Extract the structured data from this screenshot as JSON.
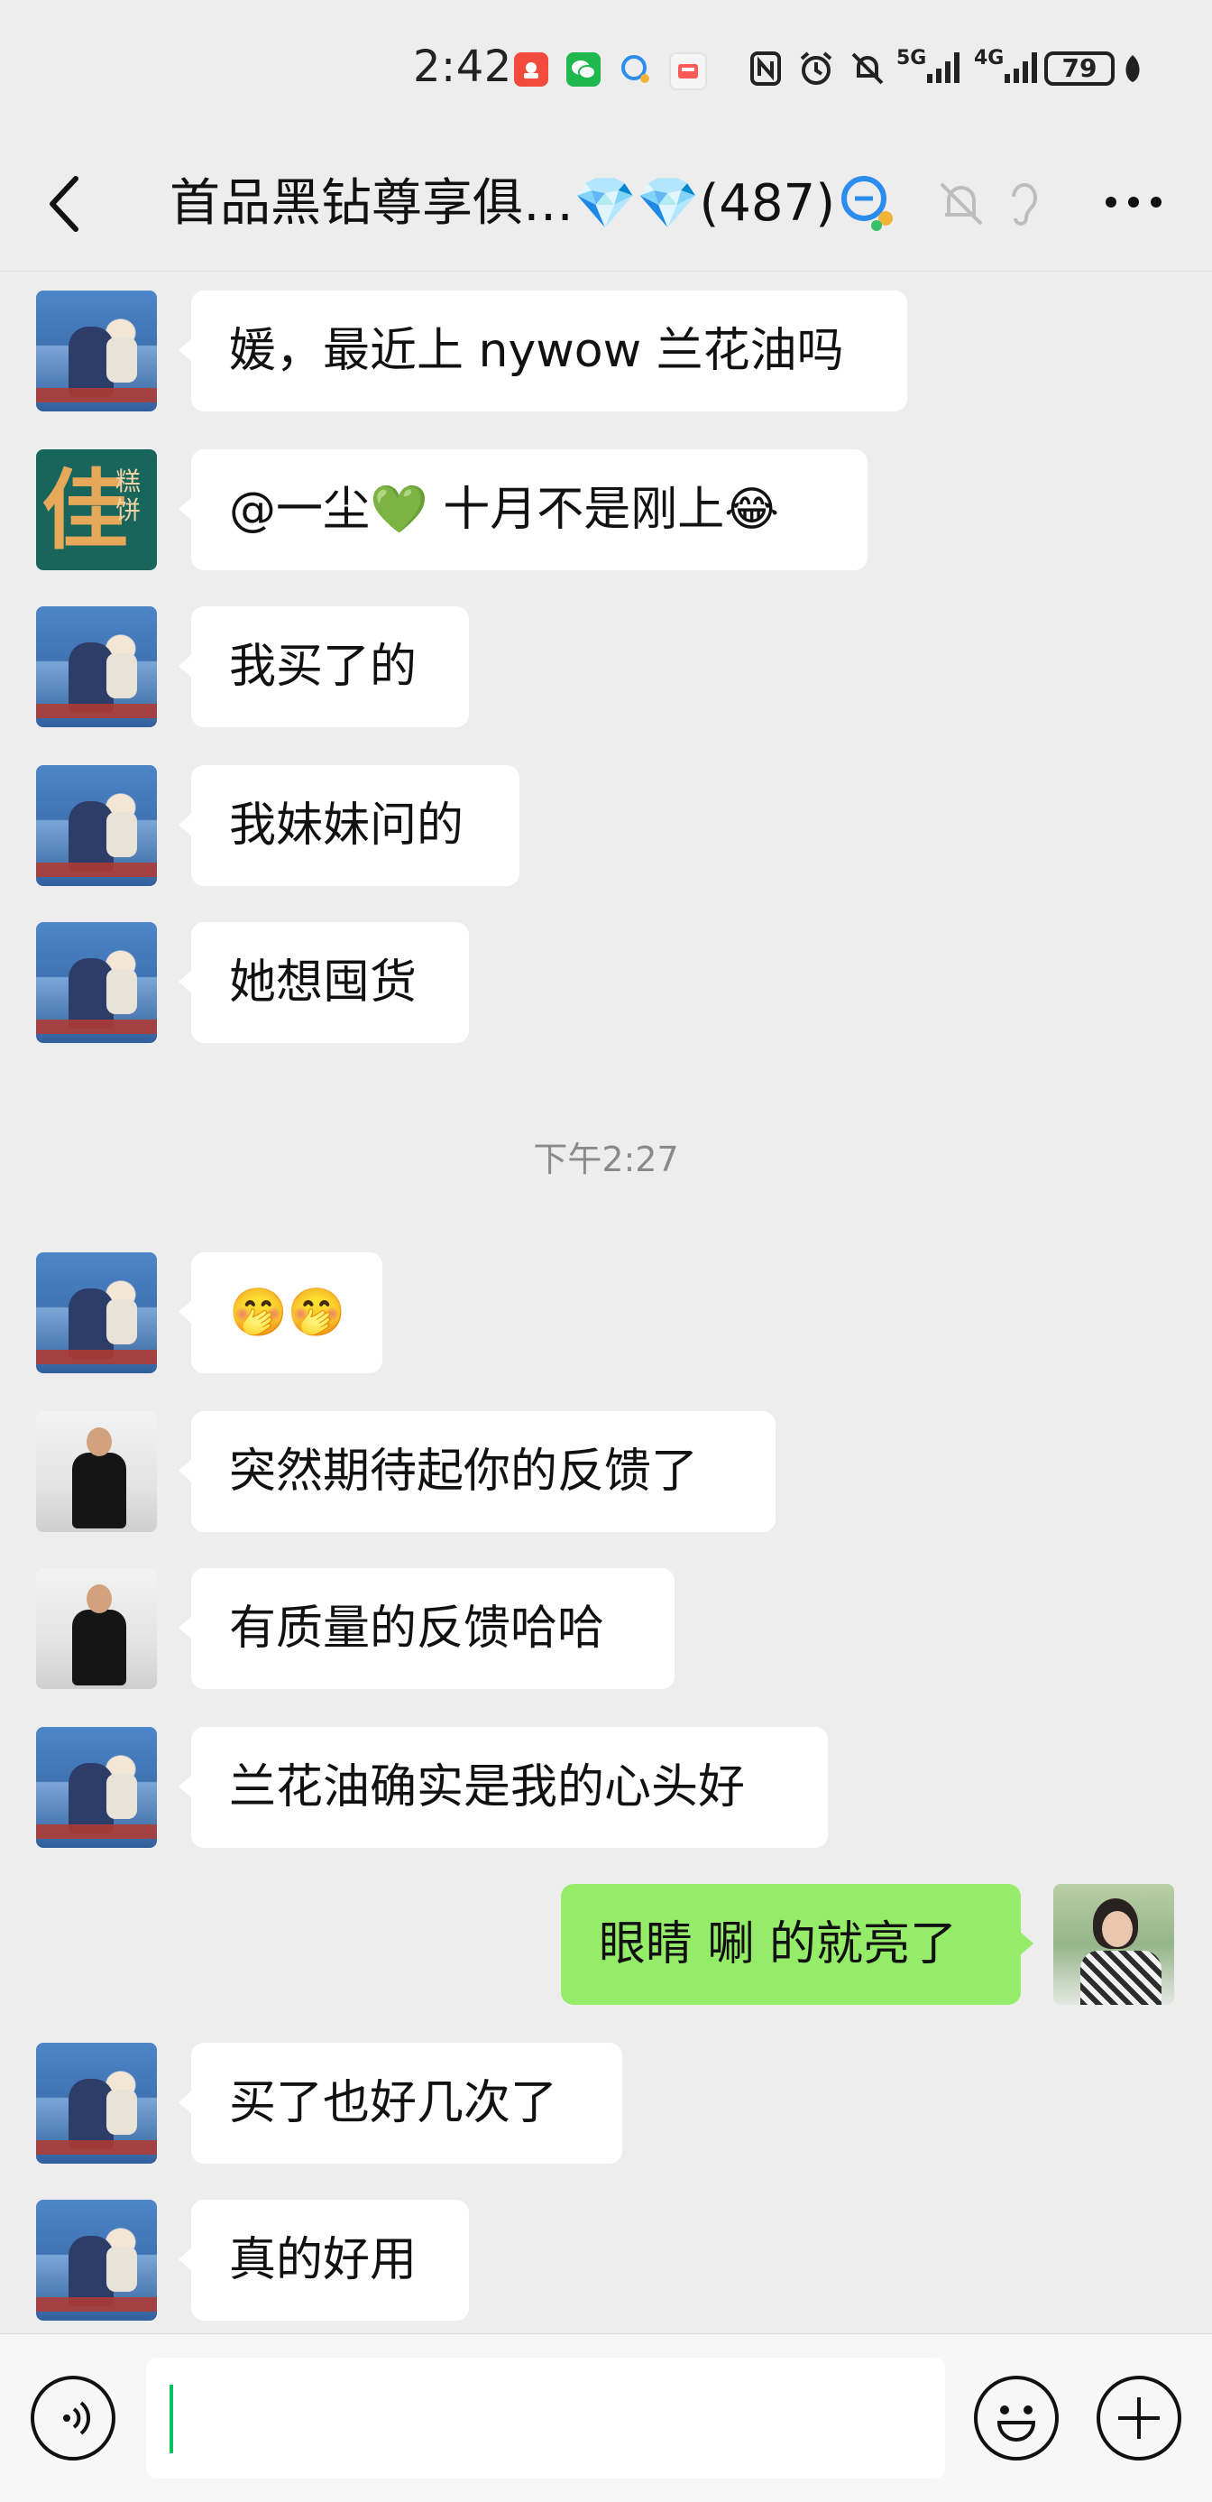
{
  "status_bar": {
    "time": "2:42",
    "battery": "79",
    "network_5g": "5G",
    "network_4g": "4G"
  },
  "header": {
    "title": "首品黑钻尊享俱…💎💎(487)",
    "back_label": "back",
    "more_label": "more"
  },
  "messages": [
    {
      "id": 1,
      "sender": "other",
      "avatar": "sea-avatar",
      "text": "媛，最近上 nywow 兰花油吗"
    },
    {
      "id": 2,
      "sender": "other",
      "avatar": "food-avatar",
      "text_before": "@一尘",
      "heart": "💚",
      "text_after": " 十月不是刚上",
      "emoji_end": "😂"
    },
    {
      "id": 3,
      "sender": "other",
      "avatar": "sea-avatar",
      "text": "我买了的"
    },
    {
      "id": 4,
      "sender": "other",
      "avatar": "sea-avatar",
      "text": "我妹妹问的"
    },
    {
      "id": 5,
      "sender": "other",
      "avatar": "sea-avatar",
      "text": "她想囤货"
    },
    {
      "id": 6,
      "sender": "other",
      "avatar": "sea-avatar",
      "text": "🤭🤭"
    },
    {
      "id": 7,
      "sender": "other",
      "avatar": "woman-avatar",
      "text": "突然期待起你的反馈了"
    },
    {
      "id": 8,
      "sender": "other",
      "avatar": "woman-avatar",
      "text": "有质量的反馈哈哈"
    },
    {
      "id": 9,
      "sender": "other",
      "avatar": "sea-avatar",
      "text": "兰花油确实是我的心头好"
    },
    {
      "id": 10,
      "sender": "self",
      "avatar": "self-avatar",
      "text": "眼睛 唰 的就亮了"
    },
    {
      "id": 11,
      "sender": "other",
      "avatar": "sea-avatar",
      "text": "买了也好几次了"
    },
    {
      "id": 12,
      "sender": "other",
      "avatar": "sea-avatar",
      "text": "真的好用"
    }
  ],
  "timestamp": "下午2:27",
  "input": {
    "value": "",
    "placeholder": ""
  },
  "colors": {
    "background": "#ededed",
    "self_bubble": "#95ec69",
    "other_bubble": "#ffffff",
    "accent": "#07c160"
  },
  "icons": {
    "back": "chevron-left-icon",
    "group_members": "group-chat-icon",
    "mute": "bell-off-icon",
    "ear": "ear-icon",
    "more": "more-dots-icon",
    "voice": "voice-icon",
    "emoji": "smiley-icon",
    "plus": "plus-icon"
  }
}
